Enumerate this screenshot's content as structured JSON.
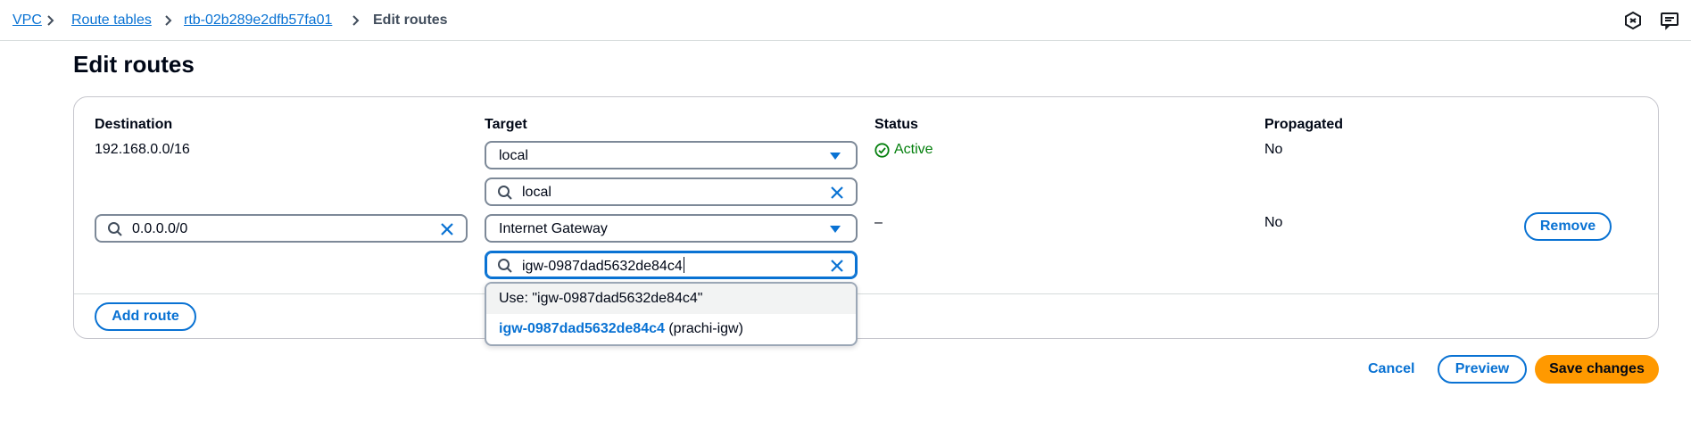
{
  "breadcrumbs": {
    "vpc": "VPC",
    "route_tables": "Route tables",
    "route_table_id": "rtb-02b289e2dfb57fa01",
    "current": "Edit routes"
  },
  "page": {
    "title": "Edit routes"
  },
  "columns": {
    "destination": "Destination",
    "target": "Target",
    "status": "Status",
    "propagated": "Propagated"
  },
  "routes": [
    {
      "destination": "192.168.0.0/16",
      "target_type": "local",
      "target_search": "local",
      "status": "Active",
      "propagated": "No"
    },
    {
      "destination": "0.0.0.0/0",
      "target_type": "Internet Gateway",
      "target_search": "igw-0987dad5632de84c4",
      "status": "–",
      "propagated": "No",
      "remove_label": "Remove"
    }
  ],
  "dropdown": {
    "use_option": "Use: \"igw-0987dad5632de84c4\"",
    "option_id": "igw-0987dad5632de84c4",
    "option_name": "(prachi-igw)"
  },
  "actions": {
    "add_route": "Add route",
    "cancel": "Cancel",
    "preview": "Preview",
    "save": "Save changes"
  },
  "colors": {
    "link": "#0972d3",
    "success": "#037f0c",
    "primary_button": "#ff9900"
  }
}
